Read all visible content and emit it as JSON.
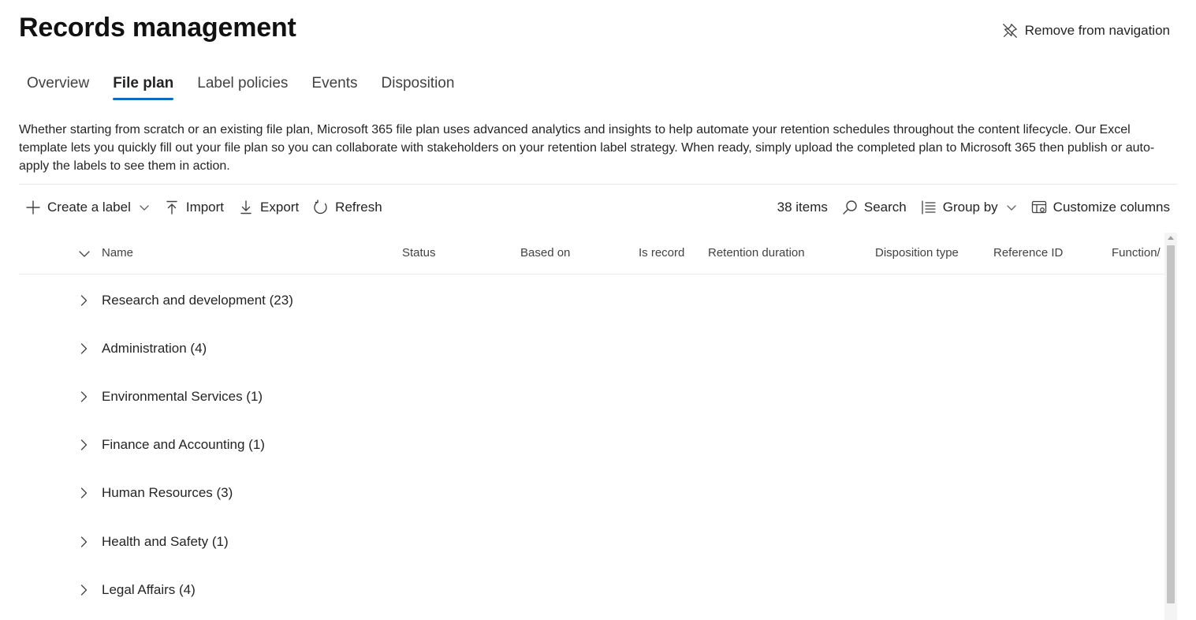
{
  "page": {
    "title": "Records management",
    "remove_nav_label": "Remove from navigation"
  },
  "tabs": [
    {
      "label": "Overview",
      "active": false
    },
    {
      "label": "File plan",
      "active": true
    },
    {
      "label": "Label policies",
      "active": false
    },
    {
      "label": "Events",
      "active": false
    },
    {
      "label": "Disposition",
      "active": false
    }
  ],
  "description": "Whether starting from scratch or an existing file plan, Microsoft 365 file plan uses advanced analytics and insights to help automate your retention schedules throughout the content lifecycle. Our Excel template lets you quickly fill out your file plan so you can collaborate with stakeholders on your retention label strategy. When ready, simply upload the completed plan to Microsoft 365 then publish or auto-apply the labels to see them in action.",
  "toolbar": {
    "create_label": "Create a label",
    "import": "Import",
    "export": "Export",
    "refresh": "Refresh",
    "item_count": "38 items",
    "search": "Search",
    "group_by": "Group by",
    "customize_columns": "Customize columns"
  },
  "columns": [
    "Name",
    "Status",
    "Based on",
    "Is record",
    "Retention duration",
    "Disposition type",
    "Reference ID",
    "Function/"
  ],
  "groups": [
    "Research and development (23)",
    "Administration (4)",
    "Environmental Services (1)",
    "Finance and Accounting (1)",
    "Human Resources (3)",
    "Health and Safety (1)",
    "Legal Affairs (4)"
  ],
  "colors": {
    "accent": "#0f6cbd",
    "text": "#242424",
    "scrollbar_thumb": "#c4c4c4"
  },
  "icons": {
    "remove_nav": "unpin-icon",
    "create": "plus-icon",
    "import": "upload-icon",
    "export": "download-icon",
    "refresh": "refresh-icon",
    "search": "search-icon",
    "group_by": "list-icon",
    "customize_columns": "table-settings-icon",
    "expand": "chevron-right-icon",
    "collapse_all": "chevron-down-icon"
  }
}
